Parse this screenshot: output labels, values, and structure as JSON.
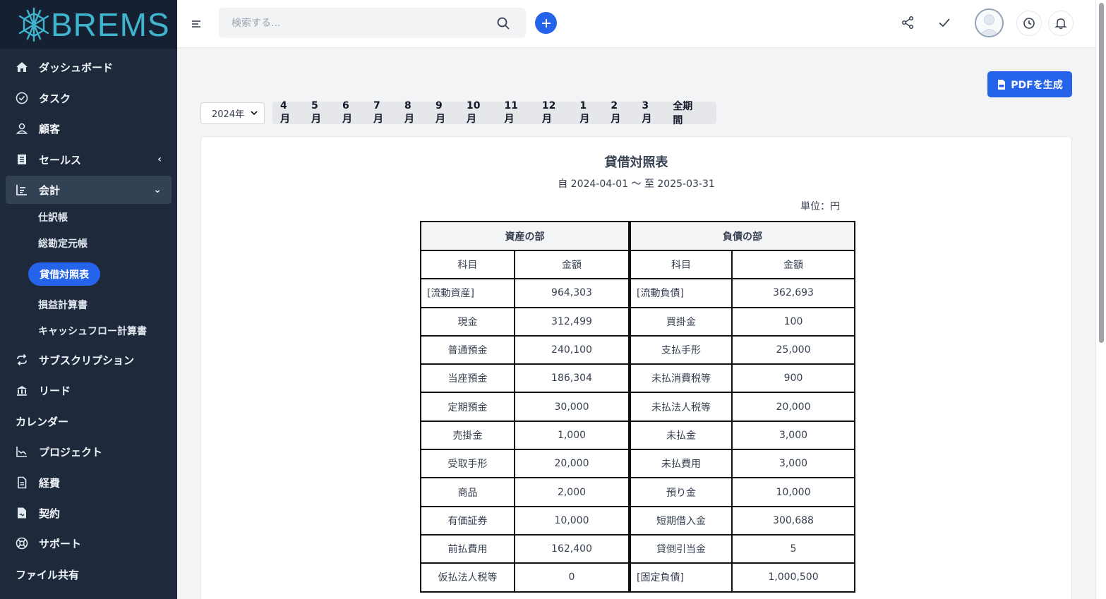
{
  "brand": {
    "name": "BREMS",
    "logo_color": "#3fb4cc"
  },
  "sidebar": {
    "items": [
      {
        "label": "ダッシュボード",
        "icon": "home-icon"
      },
      {
        "label": "タスク",
        "icon": "check-circle-icon"
      },
      {
        "label": "顧客",
        "icon": "user-icon"
      },
      {
        "label": "セールス",
        "icon": "receipt-icon",
        "chevron": "‹"
      },
      {
        "label": "会計",
        "icon": "chart-icon",
        "chevron": "⌄"
      },
      {
        "label": "サブスクリプション",
        "icon": "repeat-icon"
      },
      {
        "label": "リード",
        "icon": "lead-icon"
      },
      {
        "label": "カレンダー"
      },
      {
        "label": "プロジェクト",
        "icon": "chart-line-icon"
      },
      {
        "label": "経費",
        "icon": "document-icon"
      },
      {
        "label": "契約",
        "icon": "contract-icon"
      },
      {
        "label": "サポート",
        "icon": "lifebuoy-icon"
      },
      {
        "label": "ファイル共有"
      }
    ],
    "accounting_sub": [
      "仕訳帳",
      "総勘定元帳",
      "貸借対照表",
      "損益計算書",
      "キャッシュフロー計算書"
    ]
  },
  "header": {
    "search_placeholder": "検索する..."
  },
  "toolbar": {
    "pdf_label": "PDFを生成",
    "year": "2024年",
    "months": [
      "4月",
      "5月",
      "6月",
      "7月",
      "8月",
      "9月",
      "10月",
      "11月",
      "12月",
      "1月",
      "2月",
      "3月",
      "全期間"
    ]
  },
  "report": {
    "title": "貸借対照表",
    "period": "自 2024-04-01 〜 至 2025-03-31",
    "unit": "単位：円",
    "assets_header": "資産の部",
    "liabilities_header": "負債の部",
    "col_item": "科目",
    "col_amount": "金額",
    "rows": [
      {
        "a_item": "[流動資産]",
        "a_amount": "964,303",
        "l_item": "[流動負債]",
        "l_amount": "362,693"
      },
      {
        "a_item": "現金",
        "a_amount": "312,499",
        "l_item": "買掛金",
        "l_amount": "100"
      },
      {
        "a_item": "普通預金",
        "a_amount": "240,100",
        "l_item": "支払手形",
        "l_amount": "25,000"
      },
      {
        "a_item": "当座預金",
        "a_amount": "186,304",
        "l_item": "未払消費税等",
        "l_amount": "900"
      },
      {
        "a_item": "定期預金",
        "a_amount": "30,000",
        "l_item": "未払法人税等",
        "l_amount": "20,000"
      },
      {
        "a_item": "売掛金",
        "a_amount": "1,000",
        "l_item": "未払金",
        "l_amount": "3,000"
      },
      {
        "a_item": "受取手形",
        "a_amount": "20,000",
        "l_item": "未払費用",
        "l_amount": "3,000"
      },
      {
        "a_item": "商品",
        "a_amount": "2,000",
        "l_item": "預り金",
        "l_amount": "10,000"
      },
      {
        "a_item": "有価証券",
        "a_amount": "10,000",
        "l_item": "短期借入金",
        "l_amount": "300,688"
      },
      {
        "a_item": "前払費用",
        "a_amount": "162,400",
        "l_item": "貸倒引当金",
        "l_amount": "5"
      },
      {
        "a_item": "仮払法人税等",
        "a_amount": "0",
        "l_item": "[固定負債]",
        "l_amount": "1,000,500"
      }
    ]
  },
  "colors": {
    "sidebar_bg": "#1e293b",
    "accent": "#2563eb"
  }
}
